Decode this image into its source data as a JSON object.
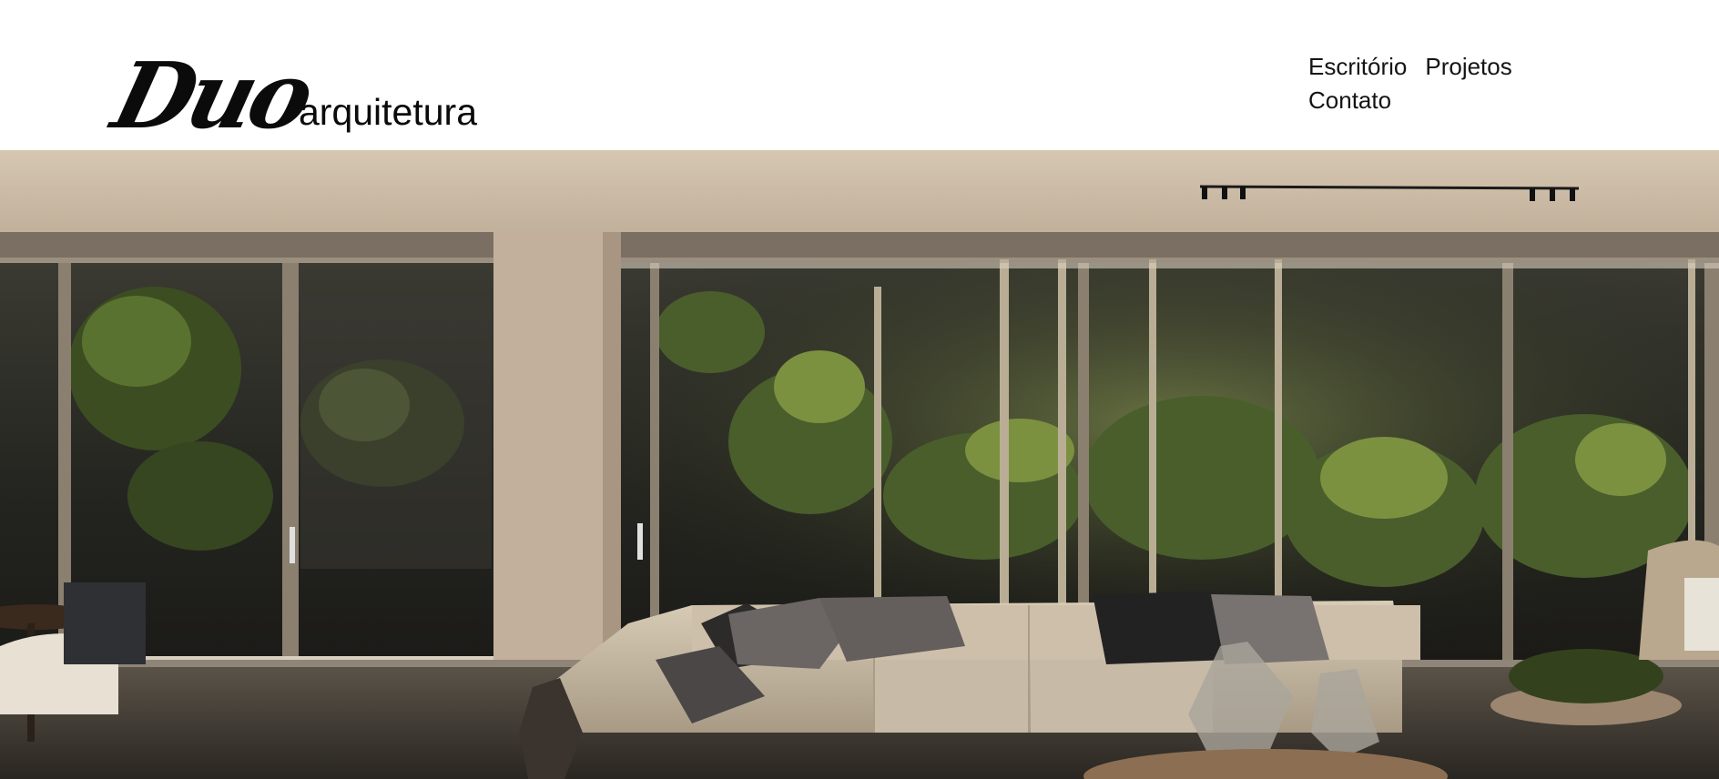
{
  "header": {
    "logo": {
      "script_text": "Duo",
      "word_text": "arquitetura"
    },
    "nav": [
      {
        "id": "escritorio",
        "label": "Escritório"
      },
      {
        "id": "projetos",
        "label": "Projetos"
      },
      {
        "id": "contato",
        "label": "Contato"
      }
    ]
  },
  "hero": {
    "icon": "living-room-photo",
    "colors": {
      "ceiling": "#cdbca6",
      "wall": "#c3b19d",
      "glass": "#2b2b25",
      "sofa": "#cfc3ae",
      "foliage": "#4a5e2c"
    }
  }
}
